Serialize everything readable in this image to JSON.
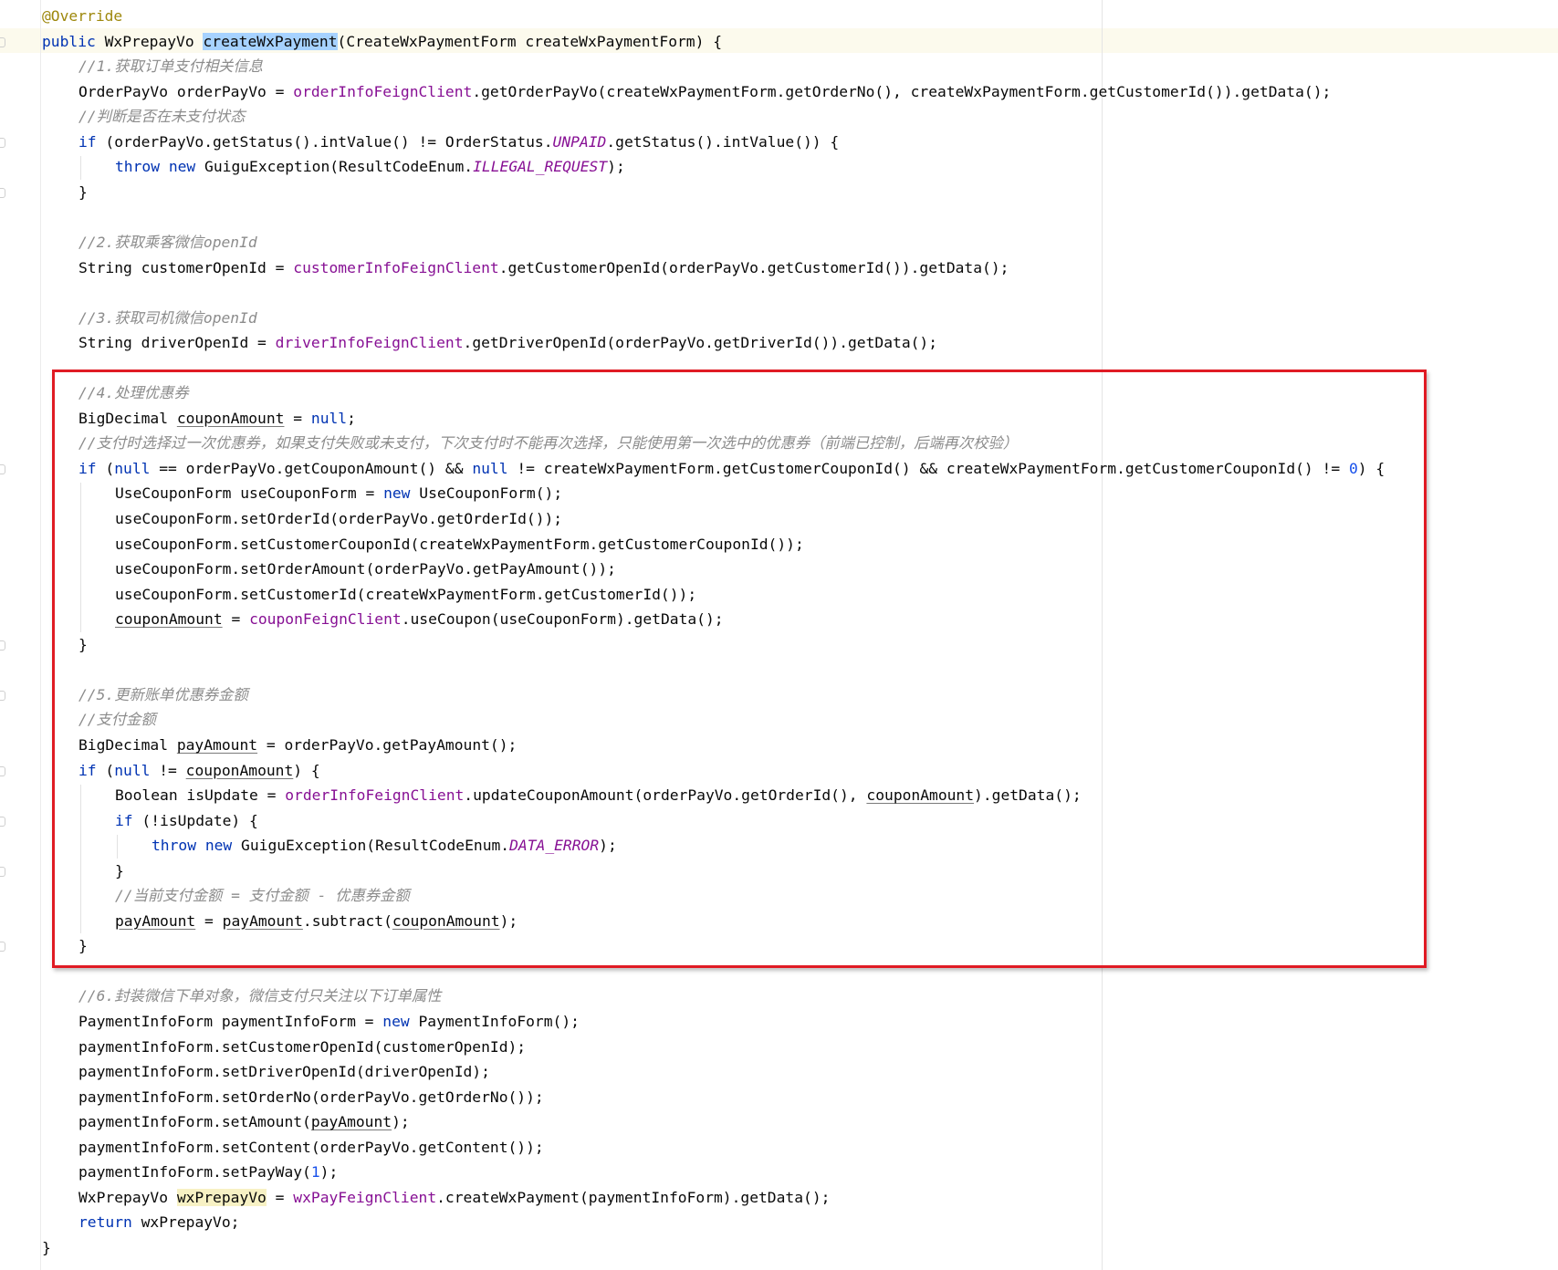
{
  "editor": {
    "annotation_box_color": "#e01b24",
    "lines": [
      {
        "indent": 0,
        "tokens": [
          {
            "t": "@Override",
            "c": "annot"
          }
        ]
      },
      {
        "indent": 0,
        "tokens": [
          {
            "t": "public",
            "c": "kw"
          },
          {
            "t": " WxPrepayVo "
          },
          {
            "t": "createWxPayment",
            "c": "sel"
          },
          {
            "t": "(CreateWxPaymentForm createWxPaymentForm) {"
          }
        ]
      },
      {
        "indent": 1,
        "tokens": [
          {
            "t": "//1.获取订单支付相关信息",
            "c": "cmt"
          }
        ]
      },
      {
        "indent": 1,
        "tokens": [
          {
            "t": "OrderPayVo orderPayVo = "
          },
          {
            "t": "orderInfoFeignClient",
            "c": "field"
          },
          {
            "t": ".getOrderPayVo(createWxPaymentForm.getOrderNo(), createWxPaymentForm.getCustomerId()).getData();"
          }
        ]
      },
      {
        "indent": 1,
        "tokens": [
          {
            "t": "//判断是否在未支付状态",
            "c": "cmt"
          }
        ]
      },
      {
        "indent": 1,
        "tokens": [
          {
            "t": "if",
            "c": "kw"
          },
          {
            "t": " (orderPayVo.getStatus().intValue() != OrderStatus."
          },
          {
            "t": "UNPAID",
            "c": "const"
          },
          {
            "t": ".getStatus().intValue()) {"
          }
        ]
      },
      {
        "indent": 2,
        "tokens": [
          {
            "t": "throw new",
            "c": "kw"
          },
          {
            "t": " GuiguException(ResultCodeEnum."
          },
          {
            "t": "ILLEGAL_REQUEST",
            "c": "const"
          },
          {
            "t": ");"
          }
        ]
      },
      {
        "indent": 1,
        "tokens": [
          {
            "t": "}"
          }
        ]
      },
      {
        "indent": 0,
        "tokens": []
      },
      {
        "indent": 1,
        "tokens": [
          {
            "t": "//2.获取乘客微信openId",
            "c": "cmt"
          }
        ]
      },
      {
        "indent": 1,
        "tokens": [
          {
            "t": "String customerOpenId = "
          },
          {
            "t": "customerInfoFeignClient",
            "c": "field"
          },
          {
            "t": ".getCustomerOpenId(orderPayVo.getCustomerId()).getData();"
          }
        ]
      },
      {
        "indent": 0,
        "tokens": []
      },
      {
        "indent": 1,
        "tokens": [
          {
            "t": "//3.获取司机微信openId",
            "c": "cmt"
          }
        ]
      },
      {
        "indent": 1,
        "tokens": [
          {
            "t": "String driverOpenId = "
          },
          {
            "t": "driverInfoFeignClient",
            "c": "field"
          },
          {
            "t": ".getDriverOpenId(orderPayVo.getDriverId()).getData();"
          }
        ]
      },
      {
        "indent": 0,
        "tokens": []
      },
      {
        "indent": 1,
        "tokens": [
          {
            "t": "//4.处理优惠券",
            "c": "cmt"
          }
        ]
      },
      {
        "indent": 1,
        "tokens": [
          {
            "t": "BigDecimal "
          },
          {
            "t": "couponAmount",
            "c": "ul"
          },
          {
            "t": " = "
          },
          {
            "t": "null",
            "c": "kw"
          },
          {
            "t": ";"
          }
        ]
      },
      {
        "indent": 1,
        "tokens": [
          {
            "t": "//支付时选择过一次优惠券，如果支付失败或未支付，下次支付时不能再次选择，只能使用第一次选中的优惠券（前端已控制，后端再次校验）",
            "c": "cmt"
          }
        ]
      },
      {
        "indent": 1,
        "tokens": [
          {
            "t": "if",
            "c": "kw"
          },
          {
            "t": " ("
          },
          {
            "t": "null",
            "c": "kw"
          },
          {
            "t": " == orderPayVo.getCouponAmount() && "
          },
          {
            "t": "null",
            "c": "kw"
          },
          {
            "t": " != createWxPaymentForm.getCustomerCouponId() && createWxPaymentForm.getCustomerCouponId() != "
          },
          {
            "t": "0",
            "c": "num"
          },
          {
            "t": ") {"
          }
        ]
      },
      {
        "indent": 2,
        "tokens": [
          {
            "t": "UseCouponForm useCouponForm = "
          },
          {
            "t": "new",
            "c": "kw"
          },
          {
            "t": " UseCouponForm();"
          }
        ]
      },
      {
        "indent": 2,
        "tokens": [
          {
            "t": "useCouponForm.setOrderId(orderPayVo.getOrderId());"
          }
        ]
      },
      {
        "indent": 2,
        "tokens": [
          {
            "t": "useCouponForm.setCustomerCouponId(createWxPaymentForm.getCustomerCouponId());"
          }
        ]
      },
      {
        "indent": 2,
        "tokens": [
          {
            "t": "useCouponForm.setOrderAmount(orderPayVo.getPayAmount());"
          }
        ]
      },
      {
        "indent": 2,
        "tokens": [
          {
            "t": "useCouponForm.setCustomerId(createWxPaymentForm.getCustomerId());"
          }
        ]
      },
      {
        "indent": 2,
        "tokens": [
          {
            "t": "couponAmount",
            "c": "ul"
          },
          {
            "t": " = "
          },
          {
            "t": "couponFeignClient",
            "c": "field"
          },
          {
            "t": ".useCoupon(useCouponForm).getData();"
          }
        ]
      },
      {
        "indent": 1,
        "tokens": [
          {
            "t": "}"
          }
        ]
      },
      {
        "indent": 0,
        "tokens": []
      },
      {
        "indent": 1,
        "tokens": [
          {
            "t": "//5.更新账单优惠券金额",
            "c": "cmt"
          }
        ]
      },
      {
        "indent": 1,
        "tokens": [
          {
            "t": "//支付金额",
            "c": "cmt"
          }
        ]
      },
      {
        "indent": 1,
        "tokens": [
          {
            "t": "BigDecimal "
          },
          {
            "t": "payAmount",
            "c": "ul"
          },
          {
            "t": " = orderPayVo.getPayAmount();"
          }
        ]
      },
      {
        "indent": 1,
        "tokens": [
          {
            "t": "if",
            "c": "kw"
          },
          {
            "t": " ("
          },
          {
            "t": "null",
            "c": "kw"
          },
          {
            "t": " != "
          },
          {
            "t": "couponAmount",
            "c": "ul"
          },
          {
            "t": ") {"
          }
        ]
      },
      {
        "indent": 2,
        "tokens": [
          {
            "t": "Boolean isUpdate = "
          },
          {
            "t": "orderInfoFeignClient",
            "c": "field"
          },
          {
            "t": ".updateCouponAmount(orderPayVo.getOrderId(), "
          },
          {
            "t": "couponAmount",
            "c": "ul"
          },
          {
            "t": ").getData();"
          }
        ]
      },
      {
        "indent": 2,
        "tokens": [
          {
            "t": "if",
            "c": "kw"
          },
          {
            "t": " (!isUpdate) {"
          }
        ]
      },
      {
        "indent": 3,
        "tokens": [
          {
            "t": "throw new",
            "c": "kw"
          },
          {
            "t": " GuiguException(ResultCodeEnum."
          },
          {
            "t": "DATA_ERROR",
            "c": "const"
          },
          {
            "t": ");"
          }
        ]
      },
      {
        "indent": 2,
        "tokens": [
          {
            "t": "}"
          }
        ]
      },
      {
        "indent": 2,
        "tokens": [
          {
            "t": "//当前支付金额 = 支付金额 - 优惠券金额",
            "c": "cmt"
          }
        ]
      },
      {
        "indent": 2,
        "tokens": [
          {
            "t": "payAmount",
            "c": "ul"
          },
          {
            "t": " = "
          },
          {
            "t": "payAmount",
            "c": "ul"
          },
          {
            "t": ".subtract("
          },
          {
            "t": "couponAmount",
            "c": "ul"
          },
          {
            "t": ");"
          }
        ]
      },
      {
        "indent": 1,
        "tokens": [
          {
            "t": "}"
          }
        ]
      },
      {
        "indent": 0,
        "tokens": []
      },
      {
        "indent": 1,
        "tokens": [
          {
            "t": "//6.封装微信下单对象，微信支付只关注以下订单属性",
            "c": "cmt"
          }
        ]
      },
      {
        "indent": 1,
        "tokens": [
          {
            "t": "PaymentInfoForm paymentInfoForm = "
          },
          {
            "t": "new",
            "c": "kw"
          },
          {
            "t": " PaymentInfoForm();"
          }
        ]
      },
      {
        "indent": 1,
        "tokens": [
          {
            "t": "paymentInfoForm.setCustomerOpenId(customerOpenId);"
          }
        ]
      },
      {
        "indent": 1,
        "tokens": [
          {
            "t": "paymentInfoForm.setDriverOpenId(driverOpenId);"
          }
        ]
      },
      {
        "indent": 1,
        "tokens": [
          {
            "t": "paymentInfoForm.setOrderNo(orderPayVo.getOrderNo());"
          }
        ]
      },
      {
        "indent": 1,
        "tokens": [
          {
            "t": "paymentInfoForm.setAmount("
          },
          {
            "t": "payAmount",
            "c": "ul"
          },
          {
            "t": ");"
          }
        ]
      },
      {
        "indent": 1,
        "tokens": [
          {
            "t": "paymentInfoForm.setContent(orderPayVo.getContent());"
          }
        ]
      },
      {
        "indent": 1,
        "tokens": [
          {
            "t": "paymentInfoForm.setPayWay("
          },
          {
            "t": "1",
            "c": "num"
          },
          {
            "t": ");"
          }
        ]
      },
      {
        "indent": 1,
        "tokens": [
          {
            "t": "WxPrepayVo "
          },
          {
            "t": "wxPrepayVo",
            "c": "hl"
          },
          {
            "t": " = "
          },
          {
            "t": "wxPayFeignClient",
            "c": "field"
          },
          {
            "t": ".createWxPayment(paymentInfoForm).getData();"
          }
        ]
      },
      {
        "indent": 1,
        "tokens": [
          {
            "t": "return",
            "c": "kw"
          },
          {
            "t": " wxPrepayVo;"
          }
        ]
      },
      {
        "indent": 0,
        "tokens": [
          {
            "t": "}"
          }
        ]
      }
    ]
  }
}
